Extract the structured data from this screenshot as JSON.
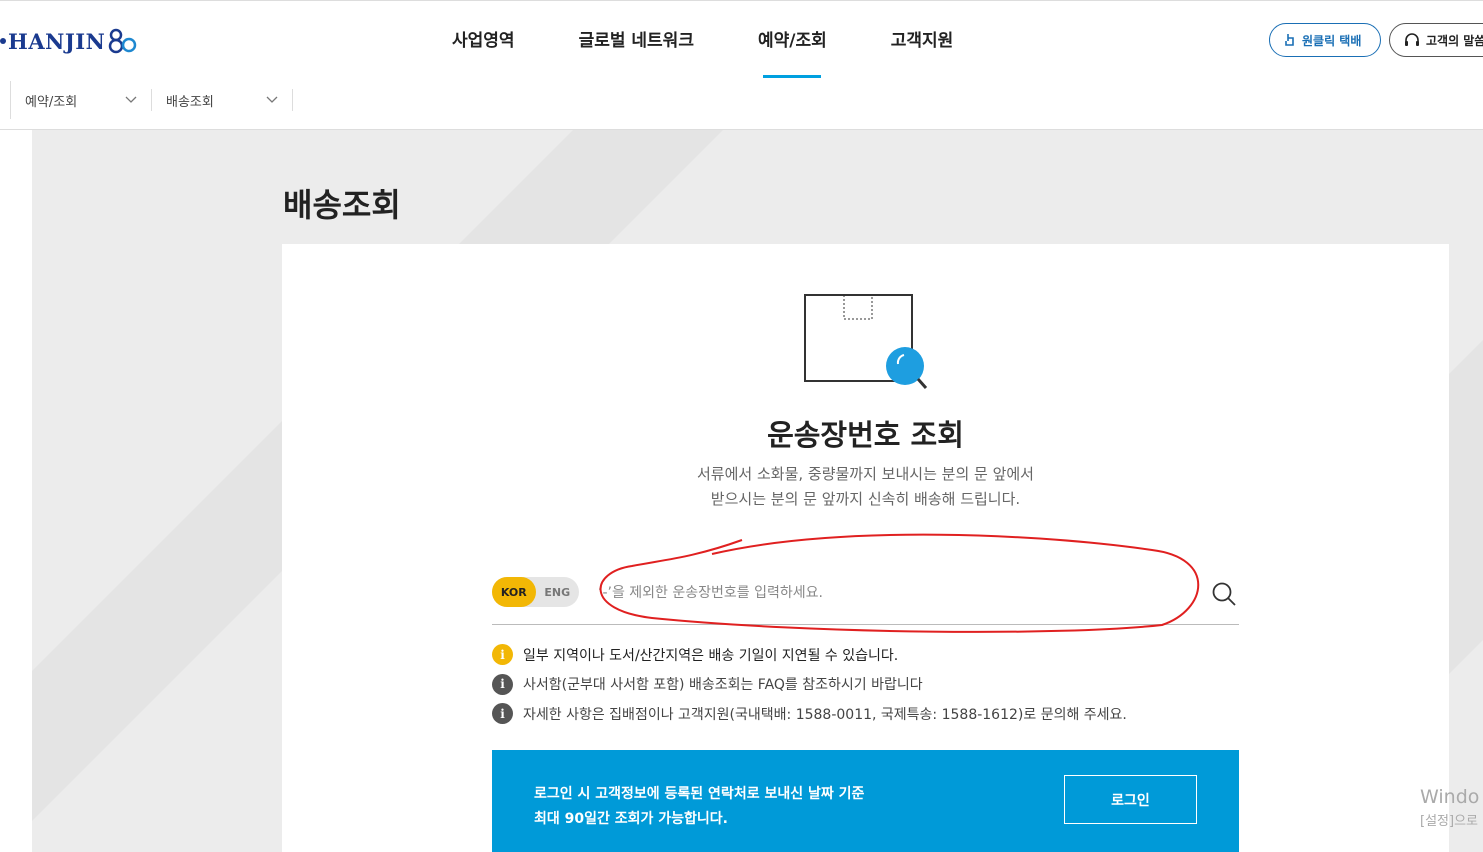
{
  "header": {
    "logo_text": "HANJIN",
    "nav": [
      "사업영역",
      "글로벌 네트워크",
      "예약/조회",
      "고객지원"
    ],
    "oneclick_label": "원클릭 택배",
    "voice_label": "고객의 말씀"
  },
  "subnav": {
    "level1": "예약/조회",
    "level2": "배송조회"
  },
  "page": {
    "title": "배송조회"
  },
  "tracking": {
    "title": "운송장번호 조회",
    "desc_line1": "서류에서 소화물, 중량물까지 보내시는 분의 문 앞에서",
    "desc_line2": "받으시는 분의 문 앞까지 신속히 배송해 드립니다.",
    "lang_kor": "KOR",
    "lang_eng": "ENG",
    "input_placeholder": "‘-’을 제외한 운송장번호를 입력하세요.",
    "input_value": ""
  },
  "notes": [
    "일부 지역이나 도서/산간지역은 배송 기일이 지연될 수 있습니다.",
    "사서함(군부대 사서함 포함) 배송조회는 FAQ를 참조하시기 바랍니다",
    "자세한 사항은 집배점이나 고객지원(국내택배: 1588-0011, 국제특송: 1588-1612)로 문의해 주세요."
  ],
  "login_panel": {
    "line1": "로그인 시 고객정보에 등록된 연락처로 보내신 날짜 기준",
    "line2": "최대 90일간 조회가 가능합니다.",
    "button": "로그인"
  },
  "watermark": {
    "line1": "Windo",
    "line2": "[설정]으로"
  },
  "colors": {
    "accent": "#00a0e0",
    "brand": "#1a3a8f",
    "lang_on": "#f2b705",
    "login_bg": "#009ad8",
    "annotation": "#e02020"
  }
}
